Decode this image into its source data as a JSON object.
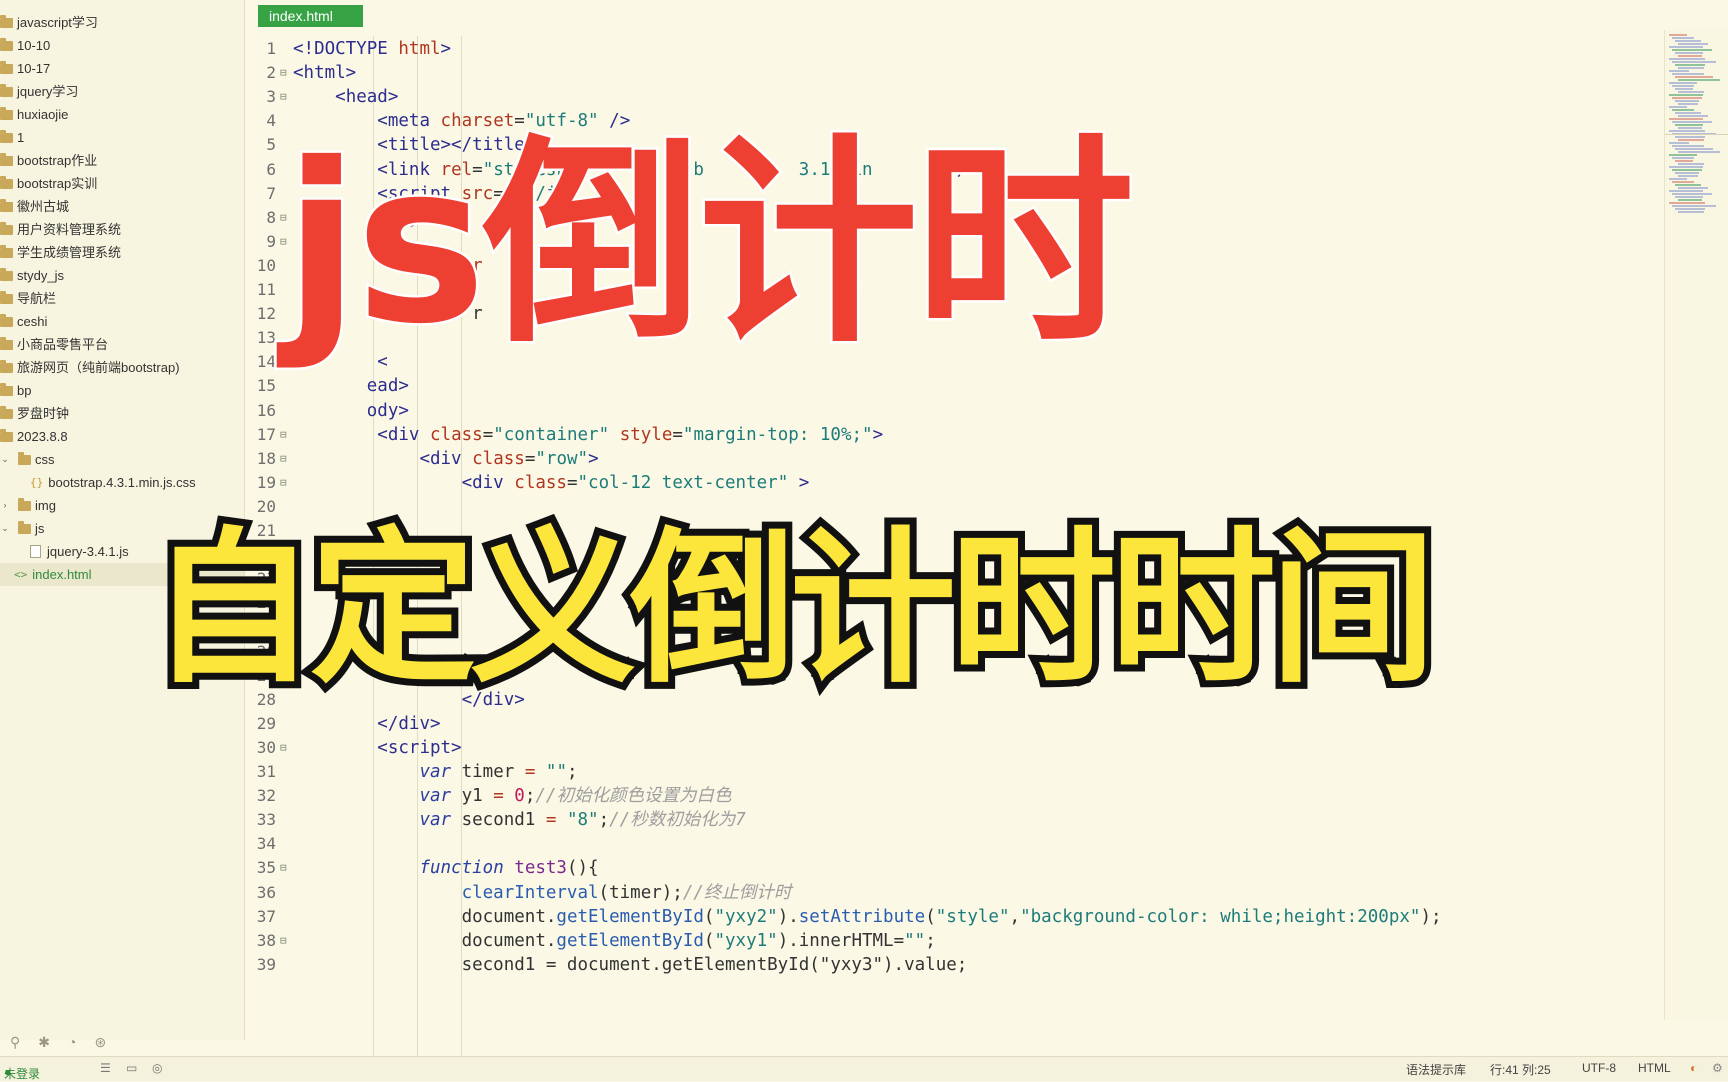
{
  "sidebar": {
    "items": [
      {
        "label": "javascript学习",
        "type": "folder"
      },
      {
        "label": "10-10",
        "type": "folder"
      },
      {
        "label": "10-17",
        "type": "folder"
      },
      {
        "label": "jquery学习",
        "type": "folder"
      },
      {
        "label": "huxiaojie",
        "type": "folder"
      },
      {
        "label": "1",
        "type": "folder"
      },
      {
        "label": "bootstrap作业",
        "type": "folder"
      },
      {
        "label": "bootstrap实训",
        "type": "folder"
      },
      {
        "label": "徽州古城",
        "type": "folder"
      },
      {
        "label": "用户资料管理系统",
        "type": "folder"
      },
      {
        "label": "学生成绩管理系统",
        "type": "folder"
      },
      {
        "label": "stydy_js",
        "type": "folder"
      },
      {
        "label": "导航栏",
        "type": "folder"
      },
      {
        "label": "ceshi",
        "type": "folder"
      },
      {
        "label": "小商品零售平台",
        "type": "folder"
      },
      {
        "label": "旅游网页（纯前端bootstrap)",
        "type": "folder"
      },
      {
        "label": "bp",
        "type": "folder"
      },
      {
        "label": "罗盘时钟",
        "type": "folder"
      },
      {
        "label": "2023.8.8",
        "type": "folder"
      },
      {
        "label": "css",
        "type": "folder-open"
      },
      {
        "label": "bootstrap.4.3.1.min.js.css",
        "type": "css-file"
      },
      {
        "label": "img",
        "type": "folder-closed"
      },
      {
        "label": "js",
        "type": "folder-open"
      },
      {
        "label": "jquery-3.4.1.js",
        "type": "file"
      },
      {
        "label": "index.html",
        "type": "html-file",
        "selected": true
      }
    ]
  },
  "editor": {
    "tab_label": "index.html"
  },
  "code_lines": [
    {
      "n": "1",
      "fold": "",
      "html": "<span class='t-tag'>&lt;!DOCTYPE</span> <span class='t-attr'>html</span><span class='t-tag'>&gt;</span>"
    },
    {
      "n": "2",
      "fold": "⊟",
      "html": "<span class='t-tag'>&lt;html&gt;</span>"
    },
    {
      "n": "3",
      "fold": "⊟",
      "html": "    <span class='t-tag'>&lt;head&gt;</span>"
    },
    {
      "n": "4",
      "fold": "",
      "html": "        <span class='t-tag'>&lt;meta</span> <span class='t-attr'>charset</span>=<span class='t-str'>\"utf-8\"</span> <span class='t-tag'>/&gt;</span>"
    },
    {
      "n": "5",
      "fold": "",
      "html": "        <span class='t-tag'>&lt;title&gt;&lt;/title&gt;</span>"
    },
    {
      "n": "6",
      "fold": "",
      "html": "        <span class='t-tag'>&lt;link</span> <span class='t-attr'>rel</span>=<span class='t-str'>\"styleshe</span>          <span class='t-str'>\"b</span>         <span class='t-str'>3.1.min</span>      <span class='t-str'>s\"</span><span class='t-tag'>/&gt;</span>"
    },
    {
      "n": "7",
      "fold": "",
      "html": "        <span class='t-tag'>&lt;script</span> <span class='t-attr'>src</span>=<span class='t-str'>\"js/jo</span>"
    },
    {
      "n": "8",
      "fold": "⊟",
      "html": "        <span class='t-tag'>&lt;style&gt;</span>"
    },
    {
      "n": "9",
      "fold": "⊟",
      "html": "           "
    },
    {
      "n": "10",
      "fold": "",
      "html": "               <span class='t-attr'>o-r</span>"
    },
    {
      "n": "11",
      "fold": "",
      "html": "               <span class='t-str'>ou</span>"
    },
    {
      "n": "12",
      "fold": "",
      "html": "               : r"
    },
    {
      "n": "13",
      "fold": "",
      "html": ""
    },
    {
      "n": "14",
      "fold": "",
      "html": "        <span class='t-tag'>&lt;</span>"
    },
    {
      "n": "15",
      "fold": "",
      "html": "    <span class='t-tag'>   ead&gt;</span>"
    },
    {
      "n": "16",
      "fold": "",
      "html": "    <span class='t-tag'>   ody&gt;</span>"
    },
    {
      "n": "17",
      "fold": "⊟",
      "html": "        <span class='t-tag'>&lt;div</span> <span class='t-attr'>class</span>=<span class='t-str'>\"container\"</span> <span class='t-attr'>style</span>=<span class='t-str'>\"margin-top: 10%;\"</span><span class='t-tag'>&gt;</span>"
    },
    {
      "n": "18",
      "fold": "⊟",
      "html": "            <span class='t-tag'>&lt;div</span> <span class='t-attr'>class</span>=<span class='t-str'>\"row\"</span><span class='t-tag'>&gt;</span>"
    },
    {
      "n": "19",
      "fold": "⊟",
      "html": "                <span class='t-tag'>&lt;div</span> <span class='t-attr'>class</span>=<span class='t-str'>\"col-12 text-center\"</span> <span class='t-tag'>&gt;</span>"
    },
    {
      "n": "20",
      "fold": "",
      "html": ""
    },
    {
      "n": "21",
      "fold": "",
      "html": ""
    },
    {
      "n": "22",
      "fold": "",
      "html": ""
    },
    {
      "n": "23",
      "fold": "",
      "html": ""
    },
    {
      "n": "24",
      "fold": "",
      "html": ""
    },
    {
      "n": "25",
      "fold": "",
      "html": ""
    },
    {
      "n": "26",
      "fold": "",
      "html": ""
    },
    {
      "n": "27",
      "fold": "",
      "html": ""
    },
    {
      "n": "28",
      "fold": "",
      "html": "                <span class='t-tag'>&lt;/div&gt;</span>"
    },
    {
      "n": "29",
      "fold": "",
      "html": "        <span class='t-tag'>&lt;/div&gt;</span>"
    },
    {
      "n": "30",
      "fold": "⊟",
      "html": "        <span class='t-tag'>&lt;script&gt;</span>"
    },
    {
      "n": "31",
      "fold": "",
      "html": "            <span class='t-kw'>var</span> timer <span class='t-attr'>=</span> <span class='t-str'>\"\"</span>;"
    },
    {
      "n": "32",
      "fold": "",
      "html": "            <span class='t-kw'>var</span> y1 <span class='t-attr'>=</span> <span class='t-num'>0</span>;<span class='t-com'>//初始化颜色设置为白色</span>"
    },
    {
      "n": "33",
      "fold": "",
      "html": "            <span class='t-kw'>var</span> second1 <span class='t-attr'>=</span> <span class='t-str'>\"8\"</span>;<span class='t-com'>//秒数初始化为7</span>"
    },
    {
      "n": "34",
      "fold": "",
      "html": ""
    },
    {
      "n": "35",
      "fold": "⊟",
      "html": "            <span class='t-kw'>function</span> <span class='t-fn'>test3</span>(){"
    },
    {
      "n": "36",
      "fold": "",
      "html": "                <span class='t-meth'>clearInterval</span>(timer);<span class='t-com'>//终止倒计时</span>"
    },
    {
      "n": "37",
      "fold": "",
      "html": "                document.<span class='t-meth'>getElementById</span>(<span class='t-str'>\"yxy2\"</span>).<span class='t-meth'>setAttribute</span>(<span class='t-str'>\"style\"</span>,<span class='t-str'>\"background-color: while;height:200px\"</span>);"
    },
    {
      "n": "38",
      "fold": "⊟",
      "html": "                document.<span class='t-meth'>getElementById</span>(<span class='t-str'>\"yxy1\"</span>).innerHTML=<span class='t-str'>\"\"</span>;"
    },
    {
      "n": "39",
      "fold": "",
      "html": "                second1 = document.getElementById(\"yxy3\").value;"
    }
  ],
  "overlay": {
    "title_main": "js倒计时",
    "title_sub": "自定义倒计时时间"
  },
  "statusbar": {
    "login": "未登录",
    "syntax": "语法提示库",
    "position": "行:41  列:25",
    "encoding": "UTF-8",
    "language": "HTML"
  },
  "colors": {
    "accent_tab": "#37a344",
    "title_main": "#ee3f33",
    "title_sub": "#fde63b",
    "editor_bg": "#fbf8e6"
  }
}
